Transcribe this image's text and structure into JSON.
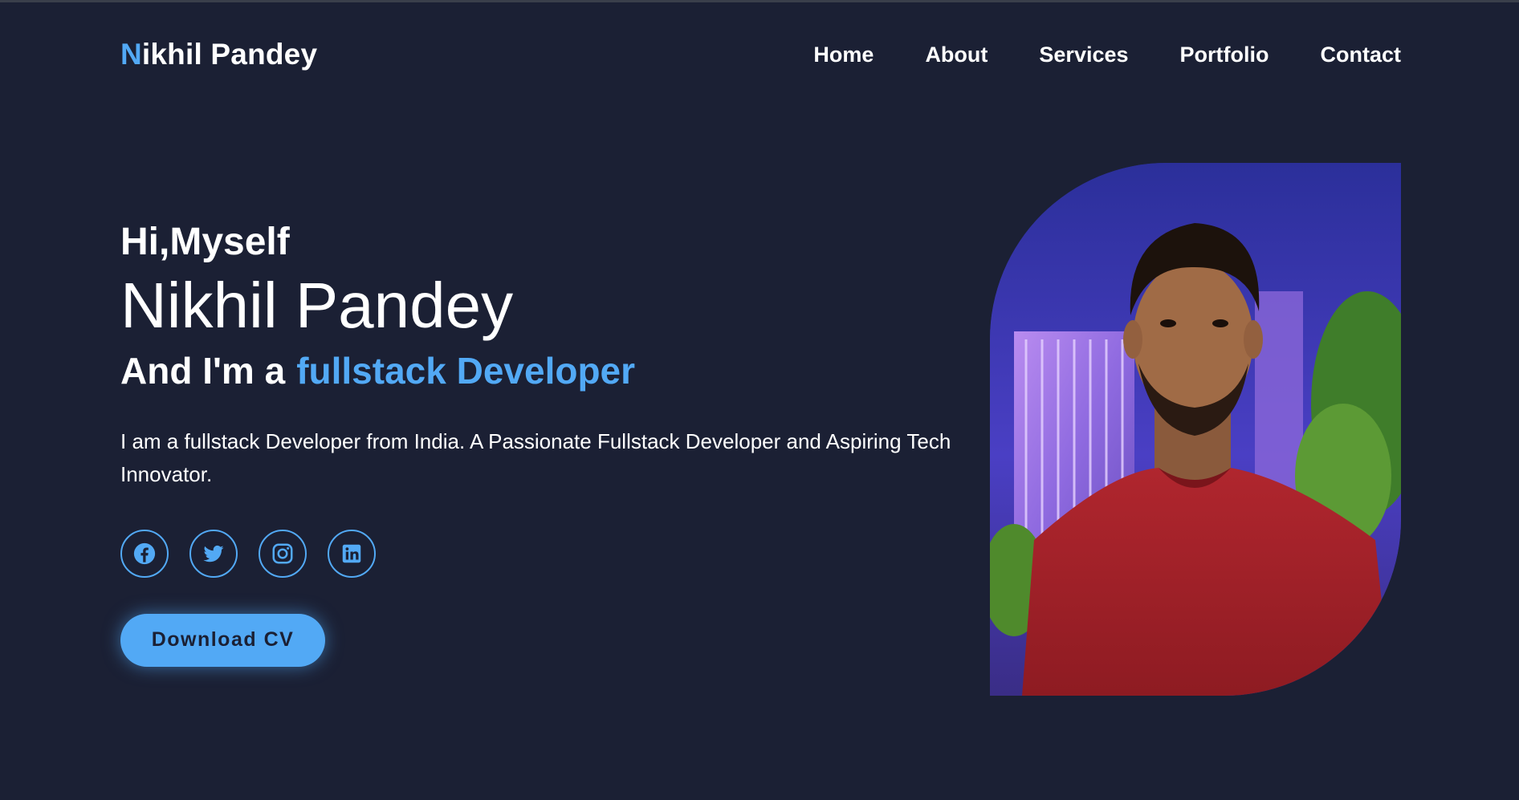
{
  "header": {
    "logo_initial": "N",
    "logo_rest": "ikhil Pandey",
    "nav": [
      {
        "label": "Home"
      },
      {
        "label": "About"
      },
      {
        "label": "Services"
      },
      {
        "label": "Portfolio"
      },
      {
        "label": "Contact"
      }
    ]
  },
  "hero": {
    "greeting": "Hi,Myself",
    "name": "Nikhil Pandey",
    "role_prefix": "And I'm a",
    "role_highlight": "fullstack Developer",
    "description": "I am a fullstack Developer from India. A Passionate Fullstack Developer and Aspiring Tech Innovator.",
    "socials": [
      {
        "icon": "facebook-icon"
      },
      {
        "icon": "twitter-icon"
      },
      {
        "icon": "instagram-icon"
      },
      {
        "icon": "linkedin-icon"
      }
    ],
    "cv_button": "Download CV"
  },
  "colors": {
    "background": "#1b2034",
    "accent": "#52a9f5",
    "text": "#ffffff"
  }
}
